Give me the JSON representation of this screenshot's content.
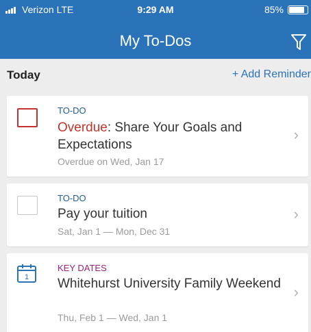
{
  "status_bar": {
    "carrier": "Verizon  LTE",
    "time": "9:29 AM",
    "battery": "85%",
    "battery_level": 0.85
  },
  "header": {
    "title": "My To-Dos",
    "filter_icon": "filter-icon"
  },
  "section": {
    "title": "Today",
    "add_plus": "+",
    "add_label": "Add Reminder"
  },
  "cards": [
    {
      "type": "TO-DO",
      "overdue_prefix": "Overdue",
      "title_rest": ": Share Your Goals and Expectations",
      "subtitle": "Overdue on Wed, Jan 17",
      "icon": "checkbox-overdue",
      "accent": "#c4332b"
    },
    {
      "type": "TO-DO",
      "title": "Pay your tuition",
      "subtitle": "Sat, Jan 1 — Mon, Dec 31",
      "icon": "checkbox"
    },
    {
      "type": "KEY DATES",
      "title": "Whitehurst University Family Weekend",
      "subtitle": "Thu, Feb 1 — Wed, Jan 1",
      "icon": "calendar-icon",
      "accent": "#a31c7c"
    }
  ],
  "chevron": "›",
  "colors": {
    "header": "#2b73b9",
    "background": "#ededed",
    "overdue": "#c4332b",
    "todo_type": "#1f5d96",
    "key_dates_type": "#a31c7c"
  }
}
